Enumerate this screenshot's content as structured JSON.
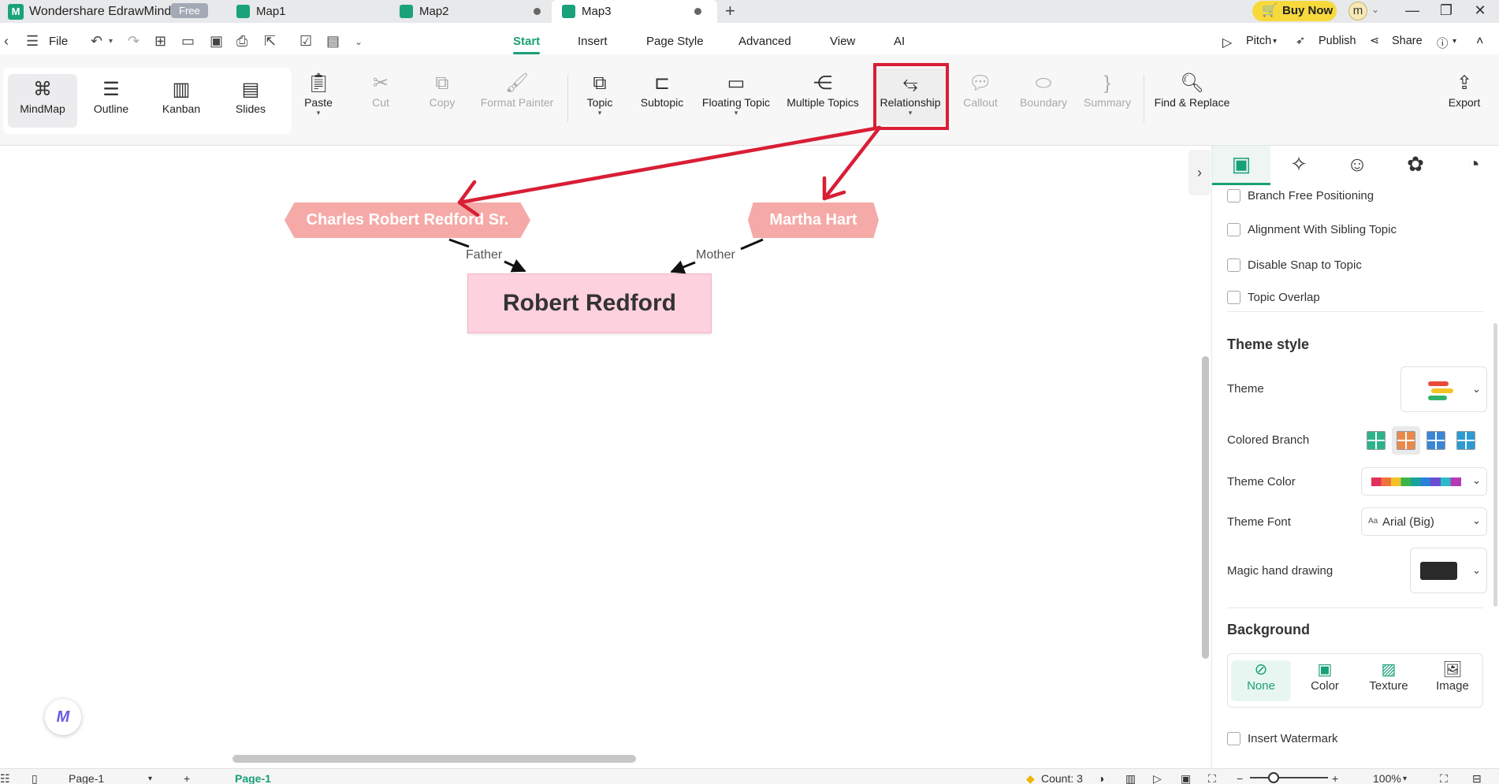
{
  "titlebar": {
    "app_name": "Wondershare EdrawMind",
    "badge": "Free",
    "tabs": [
      {
        "label": "Map1"
      },
      {
        "label": "Map2"
      },
      {
        "label": "Map3"
      }
    ],
    "buy_now": "Buy Now",
    "avatar_letter": "m"
  },
  "menubar": {
    "file": "File",
    "tabs": [
      "Start",
      "Insert",
      "Page Style",
      "Advanced",
      "View",
      "AI"
    ],
    "active_tab": "Start",
    "pitch": "Pitch",
    "publish": "Publish",
    "share": "Share"
  },
  "ribbon": {
    "views": [
      "MindMap",
      "Outline",
      "Kanban",
      "Slides"
    ],
    "paste": "Paste",
    "cut": "Cut",
    "copy": "Copy",
    "format_painter": "Format Painter",
    "topic": "Topic",
    "subtopic": "Subtopic",
    "floating_topic": "Floating Topic",
    "multiple_topics": "Multiple Topics",
    "relationship": "Relationship",
    "callout": "Callout",
    "boundary": "Boundary",
    "summary": "Summary",
    "find_replace": "Find & Replace",
    "export": "Export"
  },
  "canvas": {
    "father_topic": "Charles Robert Redford Sr.",
    "mother_topic": "Martha Hart",
    "central_topic": "Robert Redford",
    "father_label": "Father",
    "mother_label": "Mother"
  },
  "panel": {
    "checkboxes": [
      "Branch Free Positioning",
      "Alignment With Sibling Topic",
      "Disable Snap to Topic",
      "Topic Overlap"
    ],
    "theme_style_heading": "Theme style",
    "theme_label": "Theme",
    "colored_branch_label": "Colored Branch",
    "theme_color_label": "Theme Color",
    "theme_font_label": "Theme Font",
    "theme_font_value": "Arial (Big)",
    "magic_label": "Magic hand drawing",
    "background_heading": "Background",
    "bg_options": [
      "None",
      "Color",
      "Texture",
      "Image"
    ],
    "watermark": "Insert Watermark"
  },
  "statusbar": {
    "page_select": "Page-1",
    "page_tab": "Page-1",
    "count": "Count: 3",
    "zoom": "100%"
  },
  "colors": {
    "accent": "#18a077",
    "annotation_red": "#d81e35",
    "secondary_topic": "#f5aaa7",
    "central_topic": "#fdd1dd"
  }
}
